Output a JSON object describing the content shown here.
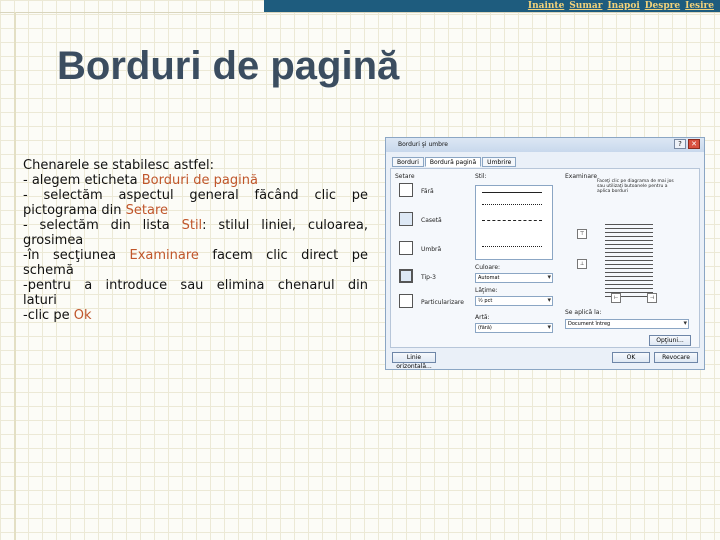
{
  "nav": {
    "items": [
      "Inainte",
      "Sumar",
      "Inapoi",
      "Despre",
      "Iesire"
    ]
  },
  "slide": {
    "title": "Borduri de pagină",
    "lines": {
      "l1a": "Chenarele se stabilesc astfel:",
      "l2a": "- alegem eticheta ",
      "l2b": "Borduri de pagină",
      "l3a": "- selectăm aspectul general făcând clic pe",
      "l4a": "pictograma din ",
      "l4b": "Setare",
      "l5a": "- selectăm din lista ",
      "l5b": "Stil",
      "l5c": ": stilul liniei, culoarea,",
      "l6a": "grosimea",
      "l7a": "-în secţiunea ",
      "l7b": "Examinare",
      "l7c": " facem clic direct pe",
      "l8a": "schemă",
      "l9a": "-pentru a introduce sau elimina chenarul din",
      "l10a": "laturi",
      "l11a": "-clic pe ",
      "l11b": "Ok"
    }
  },
  "dialog": {
    "title": "Borduri şi umbre",
    "tabs": [
      "Borduri",
      "Bordură pagină",
      "Umbrire"
    ],
    "setare_label": "Setare",
    "setare_items": [
      "Fără",
      "Casetă",
      "Umbră",
      "Tip-3",
      "Particularizare"
    ],
    "stil_label": "Stil:",
    "culoare_label": "Culoare:",
    "culoare_value": "Automat",
    "latime_label": "Lăţime:",
    "latime_value": "½ pct",
    "arta_label": "Artă:",
    "arta_value": "(fără)",
    "examinare_label": "Examinare",
    "examinare_hint": "Faceţi clic pe diagrama de mai jos sau utilizaţi butoanele pentru a aplica borduri",
    "aplicare_label": "Se aplică la:",
    "aplicare_value": "Document întreg",
    "optiuni": "Opţiuni...",
    "linie_orizontala": "Linie orizontală...",
    "ok": "OK",
    "revocare": "Revocare"
  }
}
